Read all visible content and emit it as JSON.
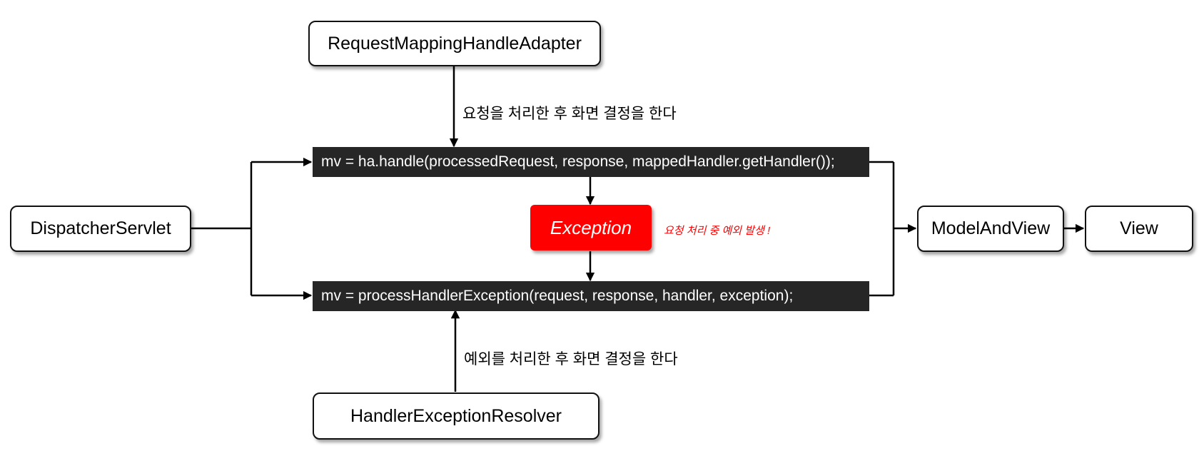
{
  "nodes": {
    "adapter": "RequestMappingHandleAdapter",
    "dispatcher": "DispatcherServlet",
    "handle_call": "mv = ha.handle(processedRequest, response, mappedHandler.getHandler());",
    "exception": "Exception",
    "process_call": "mv = processHandlerException(request, response, handler, exception);",
    "resolver": "HandlerExceptionResolver",
    "model_and_view": "ModelAndView",
    "view": "View"
  },
  "labels": {
    "adapter_edge": "요청을 처리한 후 화면 결정을 한다",
    "resolver_edge": "예외를 처리한 후 화면 결정을 한다",
    "exception_note": "요청 처리 중 예외 발생 !"
  },
  "colors": {
    "code_bg": "#262626",
    "exception_bg": "#ff0000",
    "note_text": "#ff0000"
  }
}
